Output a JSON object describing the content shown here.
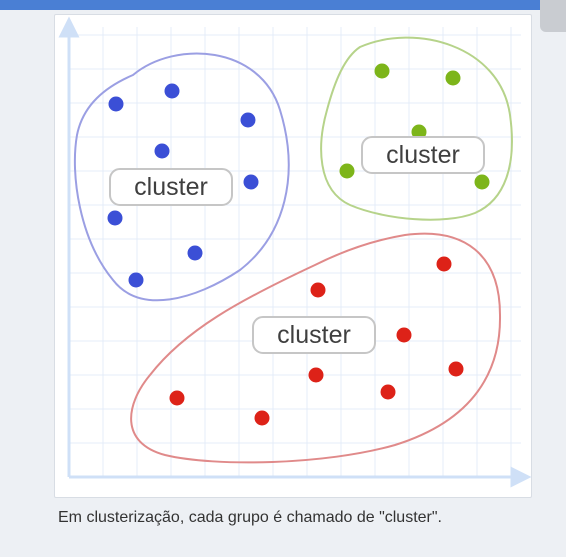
{
  "header": {
    "accent_color": "#4a7fd4"
  },
  "figure": {
    "clusters": [
      {
        "id": "blue",
        "label": "cluster",
        "point_color": "#3b4fd6",
        "outline_color": "#9b9fe3"
      },
      {
        "id": "green",
        "label": "cluster",
        "point_color": "#7db51a",
        "outline_color": "#b6d38a"
      },
      {
        "id": "red",
        "label": "cluster",
        "point_color": "#dd2218",
        "outline_color": "#e08a8a"
      }
    ]
  },
  "caption": "Em clusterização, cada grupo é chamado de \"cluster\"."
}
